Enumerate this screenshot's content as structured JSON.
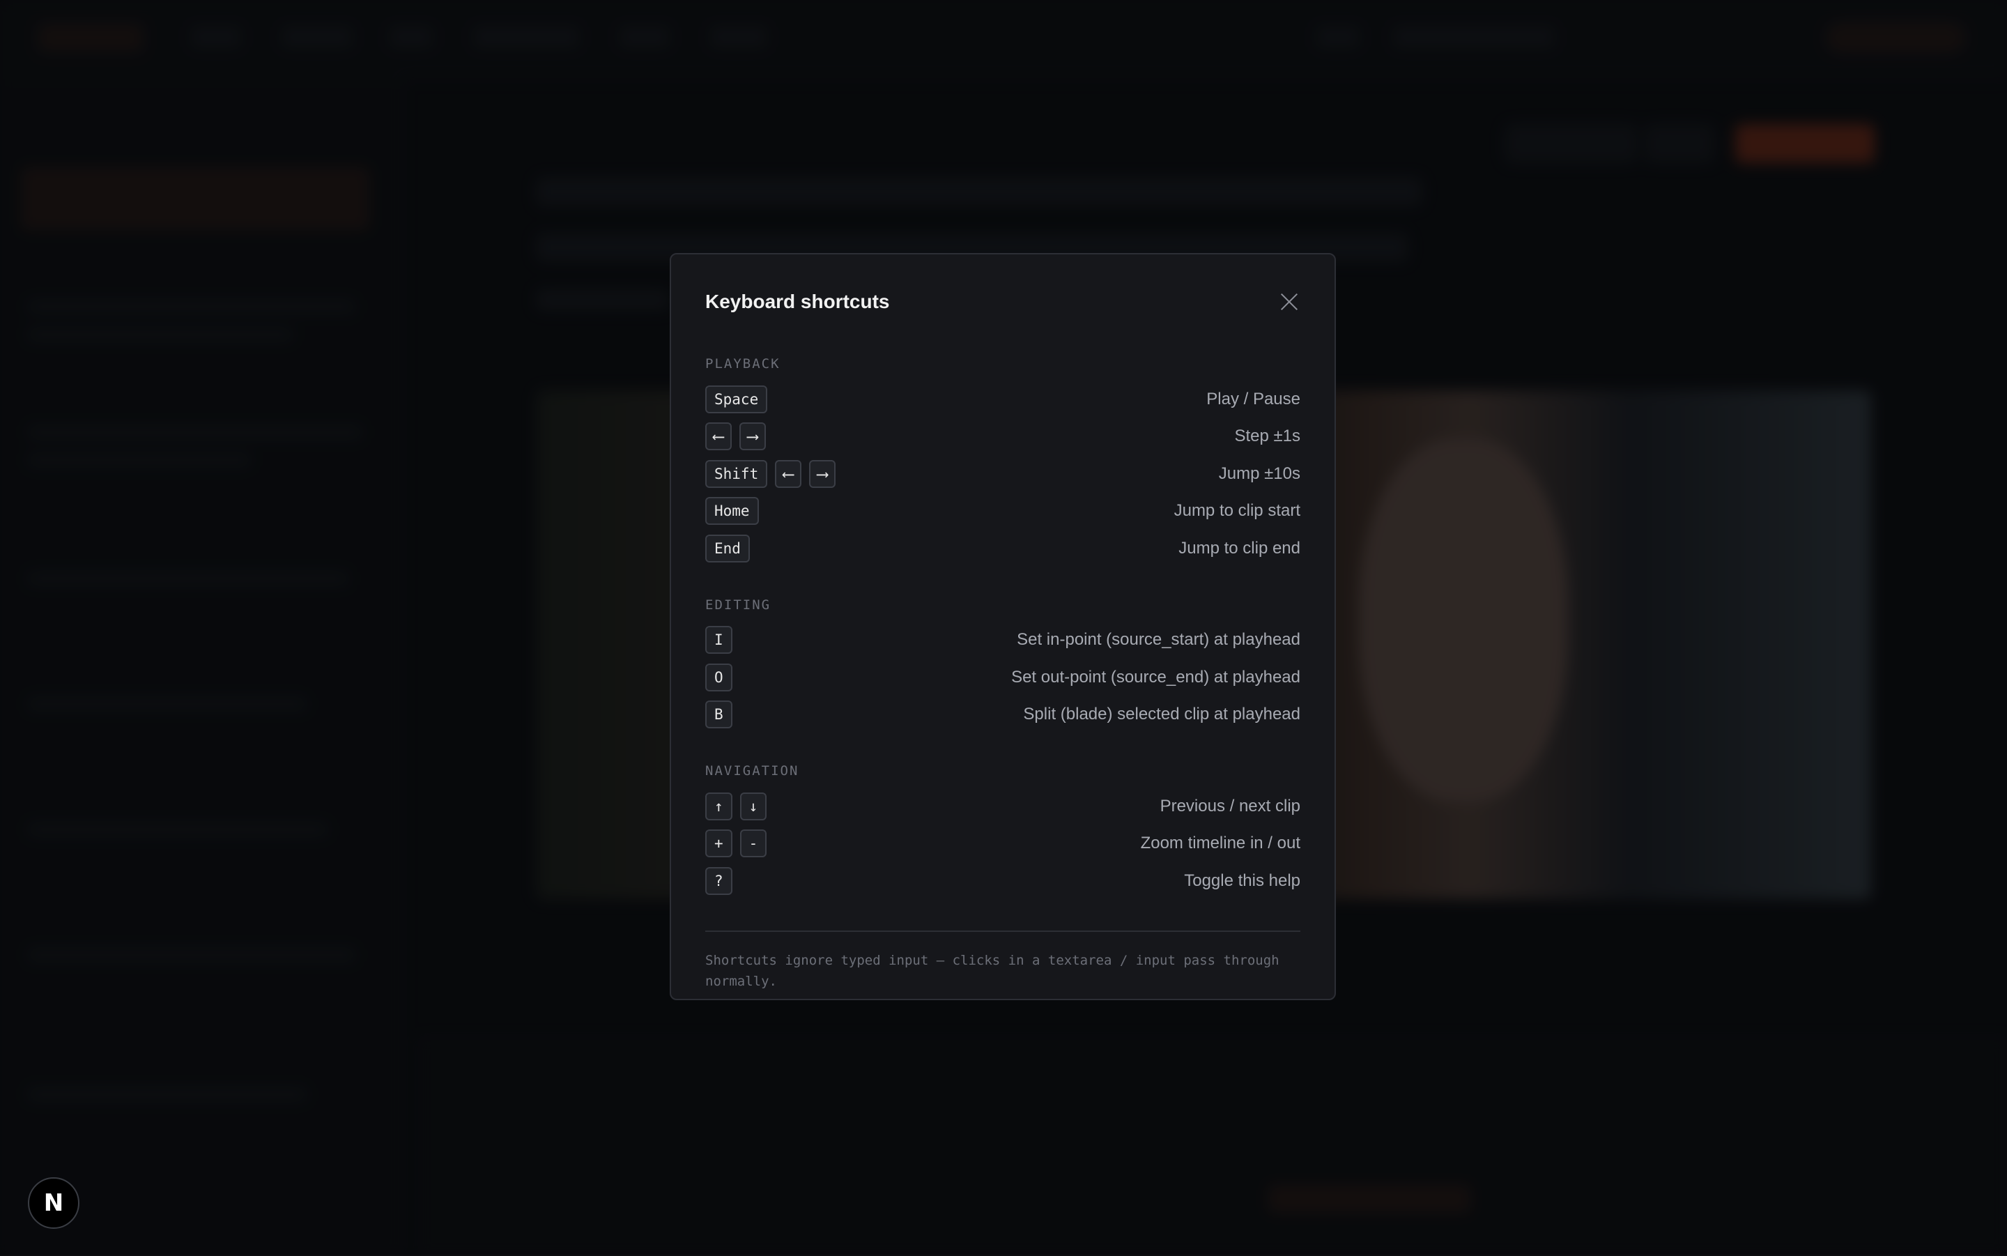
{
  "modal": {
    "title": "Keyboard shortcuts",
    "sections": [
      {
        "label": "PLAYBACK",
        "rows": [
          {
            "keys": [
              "Space"
            ],
            "desc": "Play / Pause"
          },
          {
            "keys": [
              "⟵",
              "⟶"
            ],
            "desc": "Step ±1s"
          },
          {
            "keys": [
              "Shift",
              "⟵",
              "⟶"
            ],
            "desc": "Jump ±10s"
          },
          {
            "keys": [
              "Home"
            ],
            "desc": "Jump to clip start"
          },
          {
            "keys": [
              "End"
            ],
            "desc": "Jump to clip end"
          }
        ]
      },
      {
        "label": "EDITING",
        "rows": [
          {
            "keys": [
              "I"
            ],
            "desc": "Set in-point (source_start) at playhead"
          },
          {
            "keys": [
              "O"
            ],
            "desc": "Set out-point (source_end) at playhead"
          },
          {
            "keys": [
              "B"
            ],
            "desc": "Split (blade) selected clip at playhead"
          }
        ]
      },
      {
        "label": "NAVIGATION",
        "rows": [
          {
            "keys": [
              "↑",
              "↓"
            ],
            "desc": "Previous / next clip"
          },
          {
            "keys": [
              "+",
              "-"
            ],
            "desc": "Zoom timeline in / out"
          },
          {
            "keys": [
              "?"
            ],
            "desc": "Toggle this help"
          }
        ]
      }
    ],
    "footer": "Shortcuts ignore typed input — clicks in a textarea / input pass through normally."
  },
  "badge": {
    "letter": "N"
  },
  "icons": {
    "close": "close-icon"
  },
  "colors": {
    "accent": "#c2421c",
    "surface": "#16171b",
    "border": "#2c2e35"
  }
}
